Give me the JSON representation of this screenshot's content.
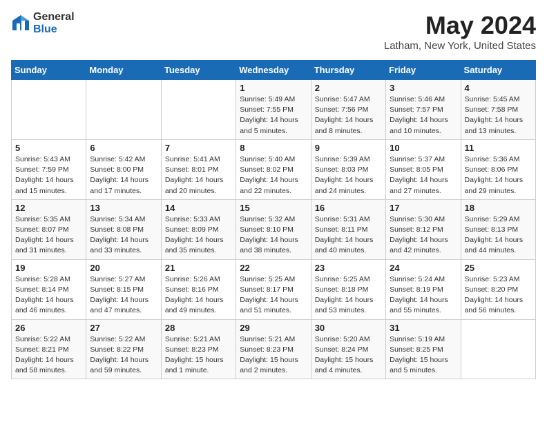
{
  "header": {
    "logo_general": "General",
    "logo_blue": "Blue",
    "title": "May 2024",
    "location": "Latham, New York, United States"
  },
  "days_of_week": [
    "Sunday",
    "Monday",
    "Tuesday",
    "Wednesday",
    "Thursday",
    "Friday",
    "Saturday"
  ],
  "weeks": [
    [
      {
        "day": "",
        "info": ""
      },
      {
        "day": "",
        "info": ""
      },
      {
        "day": "",
        "info": ""
      },
      {
        "day": "1",
        "info": "Sunrise: 5:49 AM\nSunset: 7:55 PM\nDaylight: 14 hours\nand 5 minutes."
      },
      {
        "day": "2",
        "info": "Sunrise: 5:47 AM\nSunset: 7:56 PM\nDaylight: 14 hours\nand 8 minutes."
      },
      {
        "day": "3",
        "info": "Sunrise: 5:46 AM\nSunset: 7:57 PM\nDaylight: 14 hours\nand 10 minutes."
      },
      {
        "day": "4",
        "info": "Sunrise: 5:45 AM\nSunset: 7:58 PM\nDaylight: 14 hours\nand 13 minutes."
      }
    ],
    [
      {
        "day": "5",
        "info": "Sunrise: 5:43 AM\nSunset: 7:59 PM\nDaylight: 14 hours\nand 15 minutes."
      },
      {
        "day": "6",
        "info": "Sunrise: 5:42 AM\nSunset: 8:00 PM\nDaylight: 14 hours\nand 17 minutes."
      },
      {
        "day": "7",
        "info": "Sunrise: 5:41 AM\nSunset: 8:01 PM\nDaylight: 14 hours\nand 20 minutes."
      },
      {
        "day": "8",
        "info": "Sunrise: 5:40 AM\nSunset: 8:02 PM\nDaylight: 14 hours\nand 22 minutes."
      },
      {
        "day": "9",
        "info": "Sunrise: 5:39 AM\nSunset: 8:03 PM\nDaylight: 14 hours\nand 24 minutes."
      },
      {
        "day": "10",
        "info": "Sunrise: 5:37 AM\nSunset: 8:05 PM\nDaylight: 14 hours\nand 27 minutes."
      },
      {
        "day": "11",
        "info": "Sunrise: 5:36 AM\nSunset: 8:06 PM\nDaylight: 14 hours\nand 29 minutes."
      }
    ],
    [
      {
        "day": "12",
        "info": "Sunrise: 5:35 AM\nSunset: 8:07 PM\nDaylight: 14 hours\nand 31 minutes."
      },
      {
        "day": "13",
        "info": "Sunrise: 5:34 AM\nSunset: 8:08 PM\nDaylight: 14 hours\nand 33 minutes."
      },
      {
        "day": "14",
        "info": "Sunrise: 5:33 AM\nSunset: 8:09 PM\nDaylight: 14 hours\nand 35 minutes."
      },
      {
        "day": "15",
        "info": "Sunrise: 5:32 AM\nSunset: 8:10 PM\nDaylight: 14 hours\nand 38 minutes."
      },
      {
        "day": "16",
        "info": "Sunrise: 5:31 AM\nSunset: 8:11 PM\nDaylight: 14 hours\nand 40 minutes."
      },
      {
        "day": "17",
        "info": "Sunrise: 5:30 AM\nSunset: 8:12 PM\nDaylight: 14 hours\nand 42 minutes."
      },
      {
        "day": "18",
        "info": "Sunrise: 5:29 AM\nSunset: 8:13 PM\nDaylight: 14 hours\nand 44 minutes."
      }
    ],
    [
      {
        "day": "19",
        "info": "Sunrise: 5:28 AM\nSunset: 8:14 PM\nDaylight: 14 hours\nand 46 minutes."
      },
      {
        "day": "20",
        "info": "Sunrise: 5:27 AM\nSunset: 8:15 PM\nDaylight: 14 hours\nand 47 minutes."
      },
      {
        "day": "21",
        "info": "Sunrise: 5:26 AM\nSunset: 8:16 PM\nDaylight: 14 hours\nand 49 minutes."
      },
      {
        "day": "22",
        "info": "Sunrise: 5:25 AM\nSunset: 8:17 PM\nDaylight: 14 hours\nand 51 minutes."
      },
      {
        "day": "23",
        "info": "Sunrise: 5:25 AM\nSunset: 8:18 PM\nDaylight: 14 hours\nand 53 minutes."
      },
      {
        "day": "24",
        "info": "Sunrise: 5:24 AM\nSunset: 8:19 PM\nDaylight: 14 hours\nand 55 minutes."
      },
      {
        "day": "25",
        "info": "Sunrise: 5:23 AM\nSunset: 8:20 PM\nDaylight: 14 hours\nand 56 minutes."
      }
    ],
    [
      {
        "day": "26",
        "info": "Sunrise: 5:22 AM\nSunset: 8:21 PM\nDaylight: 14 hours\nand 58 minutes."
      },
      {
        "day": "27",
        "info": "Sunrise: 5:22 AM\nSunset: 8:22 PM\nDaylight: 14 hours\nand 59 minutes."
      },
      {
        "day": "28",
        "info": "Sunrise: 5:21 AM\nSunset: 8:23 PM\nDaylight: 15 hours\nand 1 minute."
      },
      {
        "day": "29",
        "info": "Sunrise: 5:21 AM\nSunset: 8:23 PM\nDaylight: 15 hours\nand 2 minutes."
      },
      {
        "day": "30",
        "info": "Sunrise: 5:20 AM\nSunset: 8:24 PM\nDaylight: 15 hours\nand 4 minutes."
      },
      {
        "day": "31",
        "info": "Sunrise: 5:19 AM\nSunset: 8:25 PM\nDaylight: 15 hours\nand 5 minutes."
      },
      {
        "day": "",
        "info": ""
      }
    ]
  ]
}
